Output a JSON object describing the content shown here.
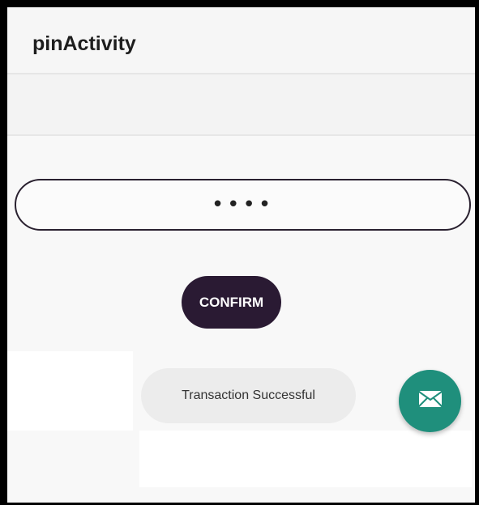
{
  "app_bar": {
    "title": "pinActivity"
  },
  "pin_field": {
    "value": "••••"
  },
  "confirm_button": {
    "label": "CONFIRM"
  },
  "toast": {
    "message": "Transaction Successful"
  },
  "fab": {
    "icon": "mail-icon",
    "color": "#1f8f7c"
  },
  "colors": {
    "primary_dark": "#2a1a33",
    "fab": "#1f8f7c",
    "background": "#f8f8f8"
  }
}
